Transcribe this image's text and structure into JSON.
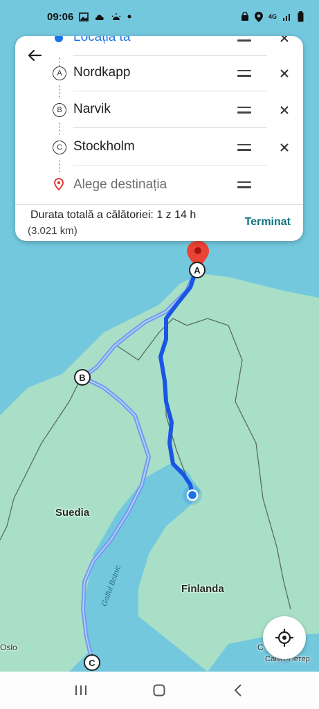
{
  "status_bar": {
    "time": "09:06",
    "network": "4G"
  },
  "directions": {
    "stops": [
      {
        "marker": "",
        "label": "Locația ta",
        "type": "current"
      },
      {
        "marker": "A",
        "label": "Nordkapp",
        "type": "stop"
      },
      {
        "marker": "B",
        "label": "Narvik",
        "type": "stop"
      },
      {
        "marker": "C",
        "label": "Stockholm",
        "type": "stop"
      },
      {
        "marker": "",
        "label": "Alege destinația",
        "type": "placeholder"
      }
    ],
    "summary": {
      "duration": "Durata totală a călătoriei: 1 z 14 h",
      "distance": "(3.021 km)"
    },
    "done_label": "Terminat"
  },
  "map": {
    "labels": {
      "sweden": "Suedia",
      "finland": "Finlanda",
      "gulf": "Golful Botnic",
      "oslo": "Oslo",
      "spb": "Санкт-Петер",
      "extra": "С"
    },
    "markers": {
      "a": "A",
      "b": "B",
      "c": "C"
    },
    "colors": {
      "water": "#74c8de",
      "land": "#a8dfc6",
      "route_primary": "#1a55e3",
      "route_alt": "#6f9bf0",
      "destination_pin": "#ea4335"
    }
  }
}
